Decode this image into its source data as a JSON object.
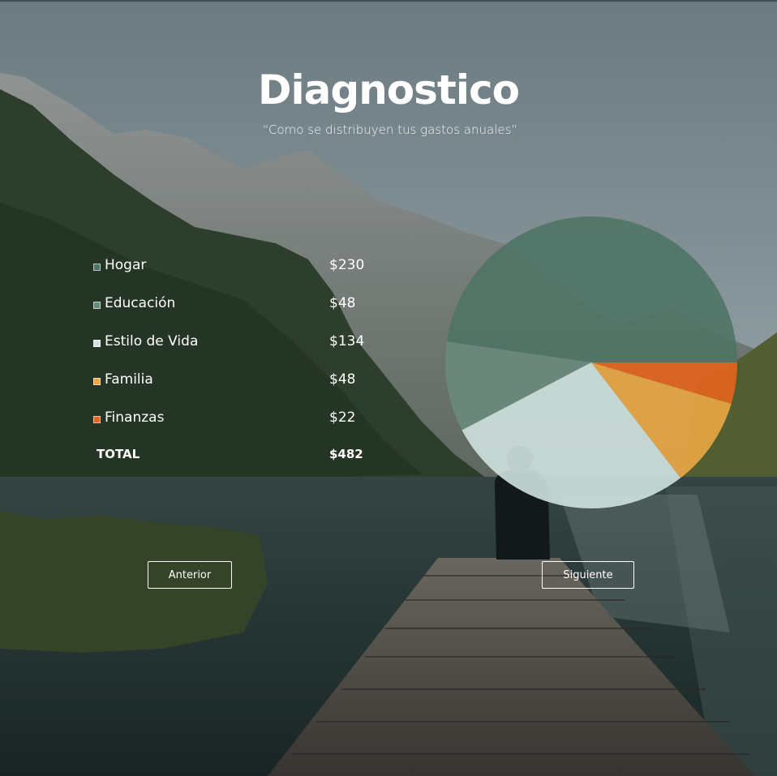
{
  "header": {
    "title": "Diagnostico",
    "subtitle": "“Como se distribuyen tus gastos anuales”"
  },
  "chart_data": {
    "type": "pie",
    "slices": [
      {
        "label": "Hogar",
        "value": 230,
        "color": "#4f7466"
      },
      {
        "label": "Educación",
        "value": 48,
        "color": "#6a8a7d"
      },
      {
        "label": "Estilo de Vida",
        "value": 134,
        "color": "#cfe2de"
      },
      {
        "label": "Familia",
        "value": 48,
        "color": "#eaa744"
      },
      {
        "label": "Finanzas",
        "value": 22,
        "color": "#e4641d"
      }
    ]
  },
  "legend": {
    "items": [
      {
        "label": "Hogar",
        "amount": "$230",
        "color": "#4f7466"
      },
      {
        "label": "Educación",
        "amount": "$48",
        "color": "#6a8a7d"
      },
      {
        "label": "Estilo de Vida",
        "amount": "$134",
        "color": "#cfe2de"
      },
      {
        "label": "Familia",
        "amount": "$48",
        "color": "#eaa744"
      },
      {
        "label": "Finanzas",
        "amount": "$22",
        "color": "#e4641d"
      }
    ],
    "total_label": "TOTAL",
    "total_amount": "$482"
  },
  "buttons": {
    "prev": "Anterior",
    "next": "Siguiente"
  }
}
